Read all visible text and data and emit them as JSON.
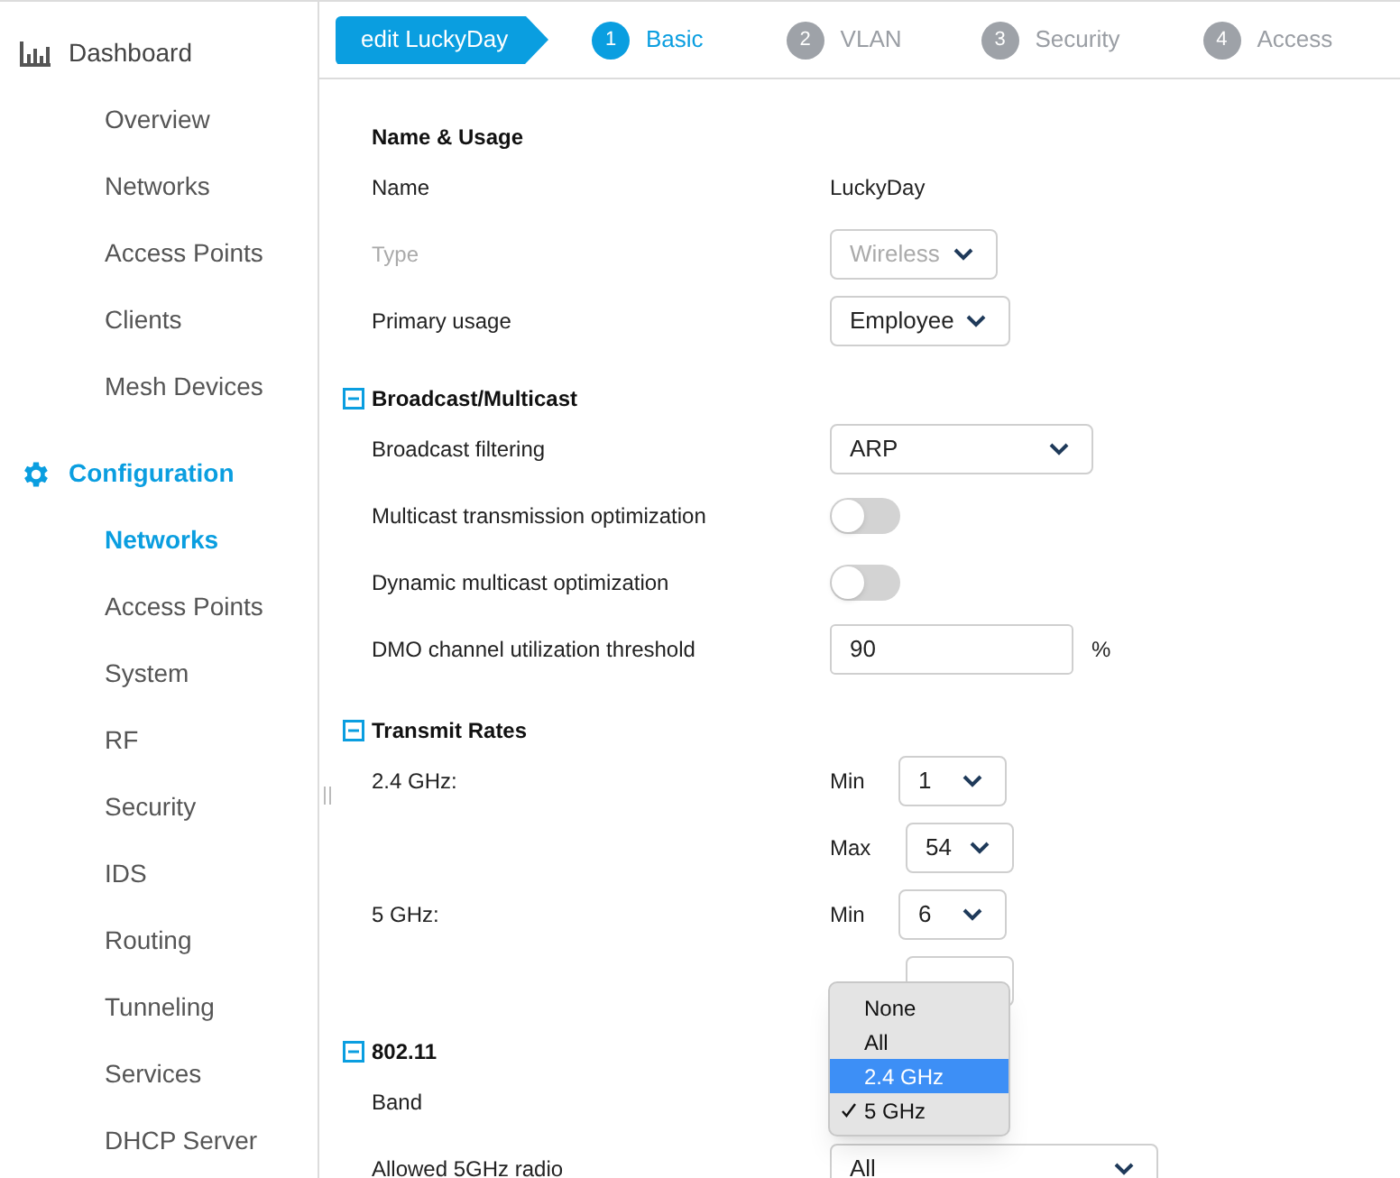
{
  "sidebar": {
    "sections": [
      {
        "title": "Dashboard",
        "selected": false,
        "items": [
          {
            "label": "Overview",
            "selected": false
          },
          {
            "label": "Networks",
            "selected": false
          },
          {
            "label": "Access Points",
            "selected": false
          },
          {
            "label": "Clients",
            "selected": false
          },
          {
            "label": "Mesh Devices",
            "selected": false
          }
        ]
      },
      {
        "title": "Configuration",
        "selected": true,
        "items": [
          {
            "label": "Networks",
            "selected": true
          },
          {
            "label": "Access Points",
            "selected": false
          },
          {
            "label": "System",
            "selected": false
          },
          {
            "label": "RF",
            "selected": false
          },
          {
            "label": "Security",
            "selected": false
          },
          {
            "label": "IDS",
            "selected": false
          },
          {
            "label": "Routing",
            "selected": false
          },
          {
            "label": "Tunneling",
            "selected": false
          },
          {
            "label": "Services",
            "selected": false
          },
          {
            "label": "DHCP Server",
            "selected": false
          }
        ]
      }
    ]
  },
  "wizard": {
    "title": "edit LuckyDay",
    "steps": [
      {
        "number": "1",
        "label": "Basic",
        "selected": true
      },
      {
        "number": "2",
        "label": "VLAN",
        "selected": false
      },
      {
        "number": "3",
        "label": "Security",
        "selected": false
      },
      {
        "number": "4",
        "label": "Access",
        "selected": false
      }
    ]
  },
  "form": {
    "sections": [
      {
        "title": "Name & Usage",
        "rows": [
          {
            "kind": "text",
            "label": "Name",
            "value": "LuckyDay"
          },
          {
            "kind": "select",
            "label": "Type",
            "value": "Wireless",
            "disabled": true
          },
          {
            "kind": "select",
            "label": "Primary usage",
            "value": "Employee"
          }
        ]
      },
      {
        "title": "Broadcast/Multicast",
        "expanded": true,
        "rows": [
          {
            "kind": "select",
            "label": "Broadcast filtering",
            "value": "ARP"
          },
          {
            "kind": "toggle",
            "label": "Multicast transmission optimization",
            "on": false
          },
          {
            "kind": "toggle",
            "label": "Dynamic multicast optimization",
            "on": false
          },
          {
            "kind": "input",
            "label": "DMO channel utilization threshold",
            "value": "90",
            "unit": "%"
          }
        ]
      },
      {
        "title": "Transmit Rates",
        "expanded": true,
        "rows": [
          {
            "kind": "rates",
            "label": "2.4 GHz:",
            "min_label": "Min",
            "min": "1",
            "max_label": "Max",
            "max": "54"
          },
          {
            "kind": "rates",
            "label": "5 GHz:",
            "min_label": "Min",
            "min": "6"
          }
        ]
      },
      {
        "title": "802.11",
        "expanded": true,
        "rows": [
          {
            "kind": "open_select",
            "label": "Band",
            "options": [
              {
                "label": "None",
                "selected": false,
                "highlighted": false
              },
              {
                "label": "All",
                "selected": false,
                "highlighted": false
              },
              {
                "label": "2.4 GHz",
                "selected": false,
                "highlighted": true
              },
              {
                "label": "5 GHz",
                "selected": true,
                "highlighted": false
              }
            ]
          },
          {
            "kind": "select",
            "label": "Allowed 5GHz radio",
            "value": "All"
          }
        ]
      }
    ]
  }
}
